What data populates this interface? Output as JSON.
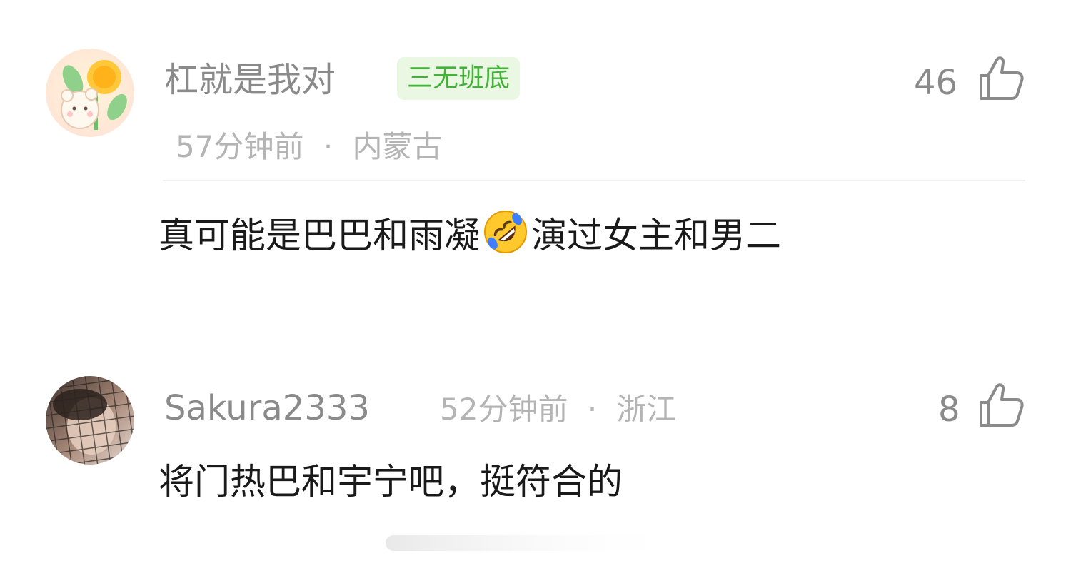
{
  "comments": [
    {
      "username": "杠就是我对",
      "badge": "三无班底",
      "time": "57分钟前",
      "location": "内蒙古",
      "likes": "46",
      "content_before_emoji": "真可能是巴巴和雨凝",
      "emoji": "rolling-on-floor-laughing",
      "content_after_emoji": "演过女主和男二",
      "avatar": "sunflower-bear-avatar"
    },
    {
      "username": "Sakura2333",
      "time": "52分钟前",
      "location": "浙江",
      "likes": "8",
      "content": "将门热巴和宇宁吧，挺符合的",
      "avatar": "photo-avatar"
    }
  ],
  "meta_separator": "·",
  "colors": {
    "username": "#8a8a8a",
    "meta": "#b4b4b4",
    "badge_bg": "#e9f7e3",
    "badge_text": "#44b23a",
    "content": "#1a1a1a"
  },
  "icons": {
    "like": "thumbs-up-icon"
  }
}
